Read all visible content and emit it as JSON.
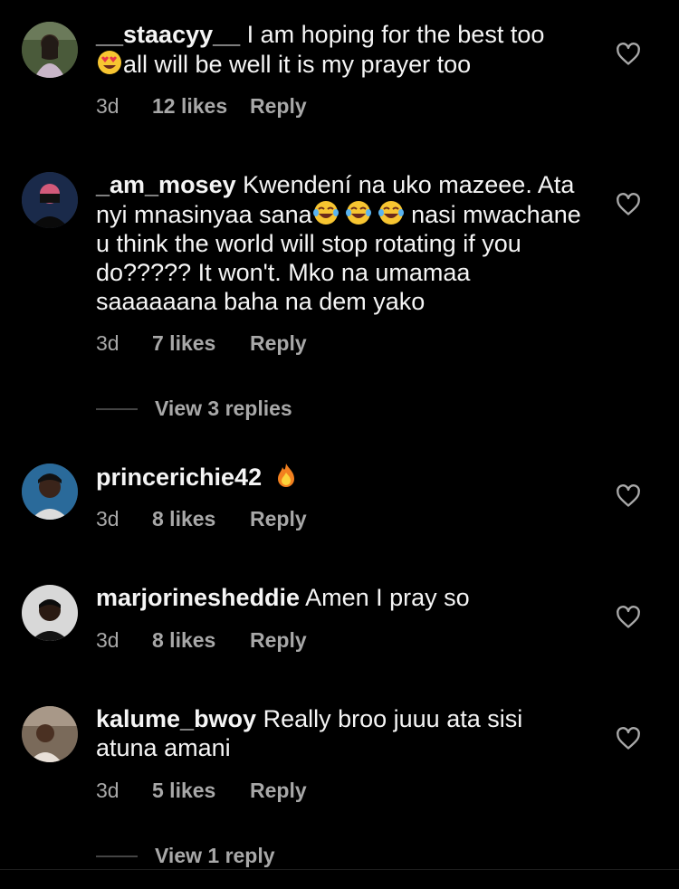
{
  "comments": [
    {
      "username": "__staacyy__",
      "text_a": " I am hoping for the best too",
      "emoji": "heart-eyes-emoji",
      "text_b": "all will be well it is my prayer too",
      "time": "3d",
      "likes": "12 likes",
      "reply": "Reply"
    },
    {
      "username": "_am_mosey",
      "text_a": " Kwendení na uko mazeee. Ata nyi mnasinyaa sana",
      "emoji": "tears-of-joy-emoji",
      "text_b": " nasi mwachane u think the world will stop rotating if you do????? It won't. Mko na umamaa saaaaaana baha na dem yako",
      "time": "3d",
      "likes": "7 likes",
      "reply": "Reply",
      "view_replies": "View 3 replies"
    },
    {
      "username": "princerichie42",
      "emoji": "fire-emoji",
      "time": "3d",
      "likes": "8 likes",
      "reply": "Reply"
    },
    {
      "username": "marjorinesheddie",
      "text_a": " Amen I pray so",
      "time": "3d",
      "likes": "8 likes",
      "reply": "Reply"
    },
    {
      "username": "kalume_bwoy",
      "text_a": " Really broo juuu ata sisi atuna amani",
      "time": "3d",
      "likes": "5 likes",
      "reply": "Reply",
      "view_replies": "View 1 reply"
    }
  ],
  "colors": {
    "background": "#000000",
    "text": "#f5f5f5",
    "meta": "#a8a8a8"
  },
  "icons": {
    "like": "heart-outline-icon"
  }
}
